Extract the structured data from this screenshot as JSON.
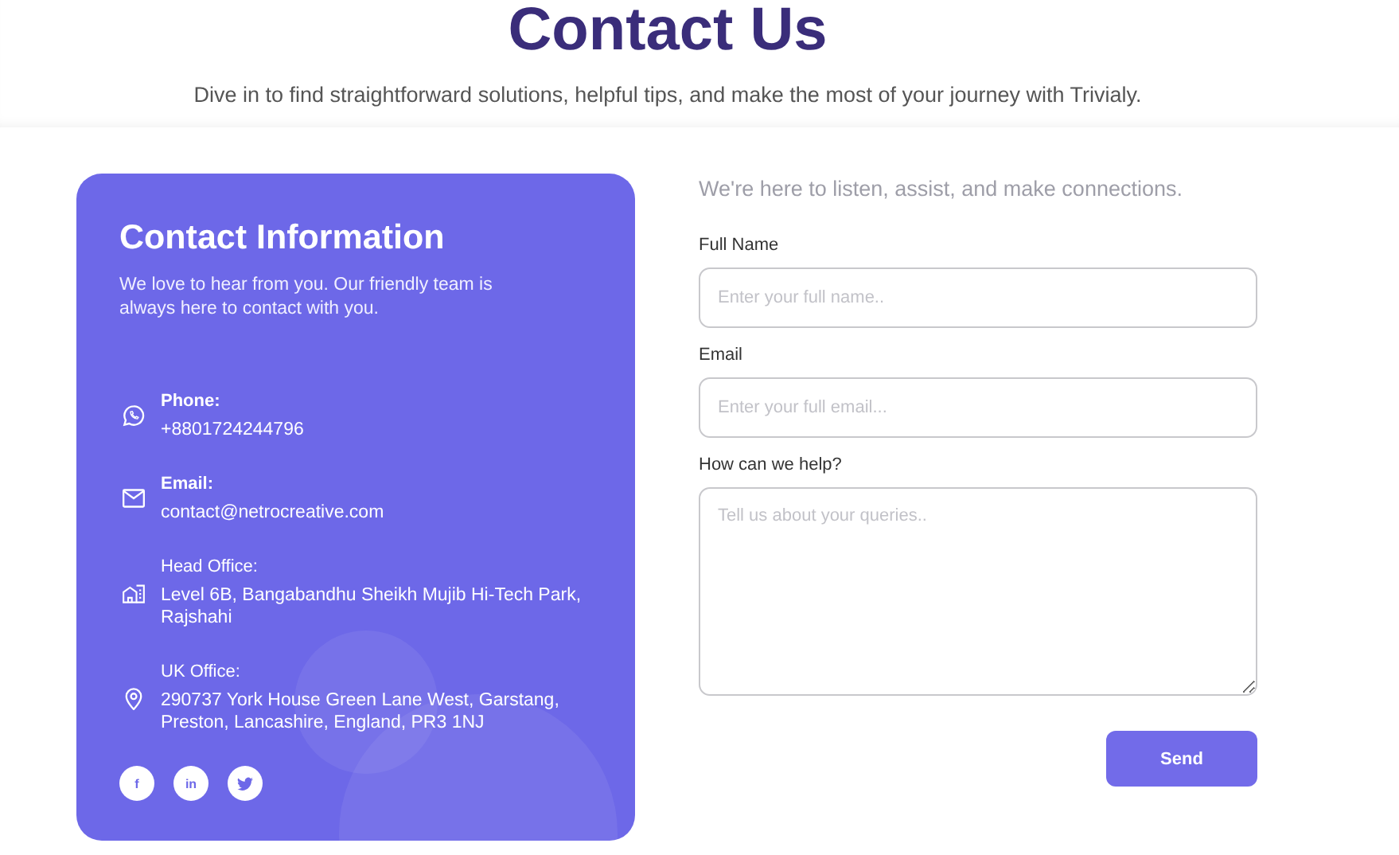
{
  "header": {
    "title": "Contact Us",
    "subtitle": "Dive in to find straightforward solutions, helpful tips, and make the most of your journey with Trivialy."
  },
  "contact_card": {
    "title": "Contact Information",
    "description": "We love to hear from you. Our friendly team is always here to contact with you.",
    "items": [
      {
        "kind": "phone",
        "label": "Phone:",
        "value": "+8801724244796",
        "bold": true
      },
      {
        "kind": "email",
        "label": "Email:",
        "value": "contact@netrocreative.com",
        "bold": true
      },
      {
        "kind": "office",
        "label": "Head Office:",
        "value": "Level 6B, Bangabandhu Sheikh Mujib Hi-Tech Park, Rajshahi",
        "bold": false
      },
      {
        "kind": "location",
        "label": "UK Office:",
        "value": "290737 York House Green Lane West, Garstang, Preston, Lancashire, England, PR3 1NJ",
        "bold": false
      }
    ],
    "social": [
      {
        "kind": "facebook",
        "glyph": "f"
      },
      {
        "kind": "linkedin",
        "glyph": "in"
      },
      {
        "kind": "twitter"
      }
    ]
  },
  "form": {
    "intro": "We're here to listen, assist, and make connections.",
    "fields": [
      {
        "kind": "input",
        "label": "Full Name",
        "placeholder": "Enter your full name.."
      },
      {
        "kind": "input",
        "label": "Email",
        "placeholder": "Enter your full email..."
      },
      {
        "kind": "textarea",
        "label": "How can we help?",
        "placeholder": "Tell us about your queries.."
      }
    ],
    "submit": "Send"
  }
}
